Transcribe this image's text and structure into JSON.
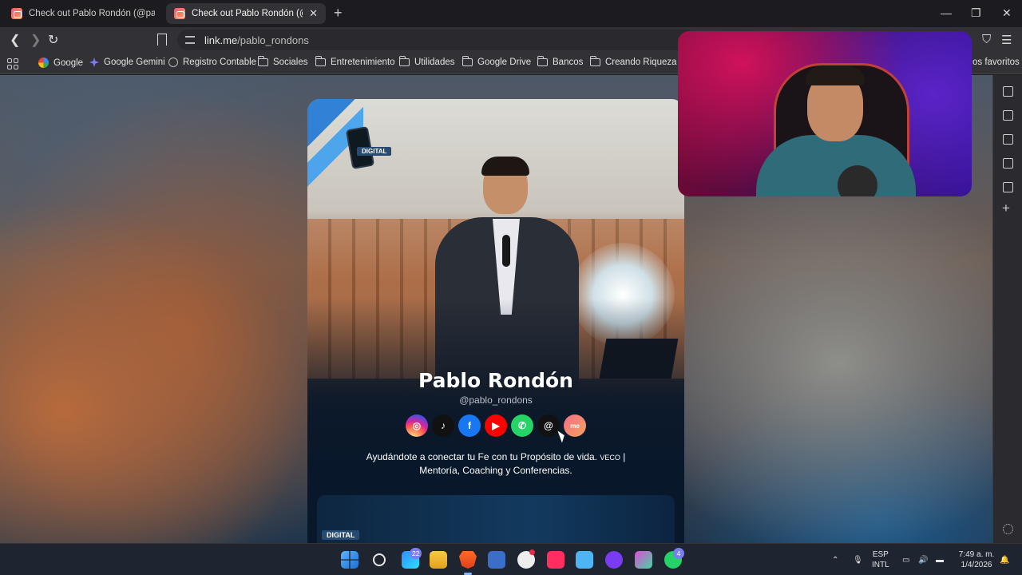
{
  "tabs": [
    {
      "title": "Check out Pablo Rondón (@pablo_ro",
      "active": false
    },
    {
      "title": "Check out Pablo Rondón (@pab",
      "active": true
    }
  ],
  "window_controls": {
    "minimize": "—",
    "maximize": "❐",
    "close": "✕"
  },
  "address_bar": {
    "host": "link.me",
    "path": "/pablo_rondons"
  },
  "bookmarks": [
    {
      "label": "Google",
      "icon": "google-logo"
    },
    {
      "label": "Google Gemini",
      "icon": "gemini-logo"
    },
    {
      "label": "Registro Contable",
      "icon": "globe-icon"
    },
    {
      "label": "Sociales",
      "icon": "folder-icon"
    },
    {
      "label": "Entretenimiento",
      "icon": "folder-icon"
    },
    {
      "label": "Utilidades",
      "icon": "folder-icon"
    },
    {
      "label": "Google Drive",
      "icon": "folder-icon"
    },
    {
      "label": "Bancos",
      "icon": "folder-icon"
    },
    {
      "label": "Creando Riqueza",
      "icon": "folder-icon"
    }
  ],
  "bookmarks_overflow": "os favoritos",
  "profile": {
    "name": "Pablo Rondón",
    "handle": "@pablo_rondons",
    "logo_badge": "DIGITAL",
    "bio_line1": "Ayudándote a conectar tu Fe con tu Propósito de vida.",
    "bio_tag": "VECO",
    "bio_separator": "|",
    "bio_line2": "Mentoría, Coaching y Conferencias.",
    "socials": [
      {
        "name": "instagram",
        "glyph": "◎"
      },
      {
        "name": "tiktok",
        "glyph": "♪"
      },
      {
        "name": "facebook",
        "glyph": "f"
      },
      {
        "name": "youtube",
        "glyph": "▶"
      },
      {
        "name": "whatsapp",
        "glyph": "✆"
      },
      {
        "name": "threads",
        "glyph": "@"
      },
      {
        "name": "linkme",
        "glyph": "me"
      }
    ],
    "second_card_badge": "DIGITAL"
  },
  "taskbar": {
    "badges": {
      "widgets": "22",
      "whatsapp": "4"
    },
    "language": {
      "line1": "ESP",
      "line2": "INTL"
    },
    "clock": {
      "time": "7:49 a. m.",
      "date": "1/4/2026"
    }
  }
}
